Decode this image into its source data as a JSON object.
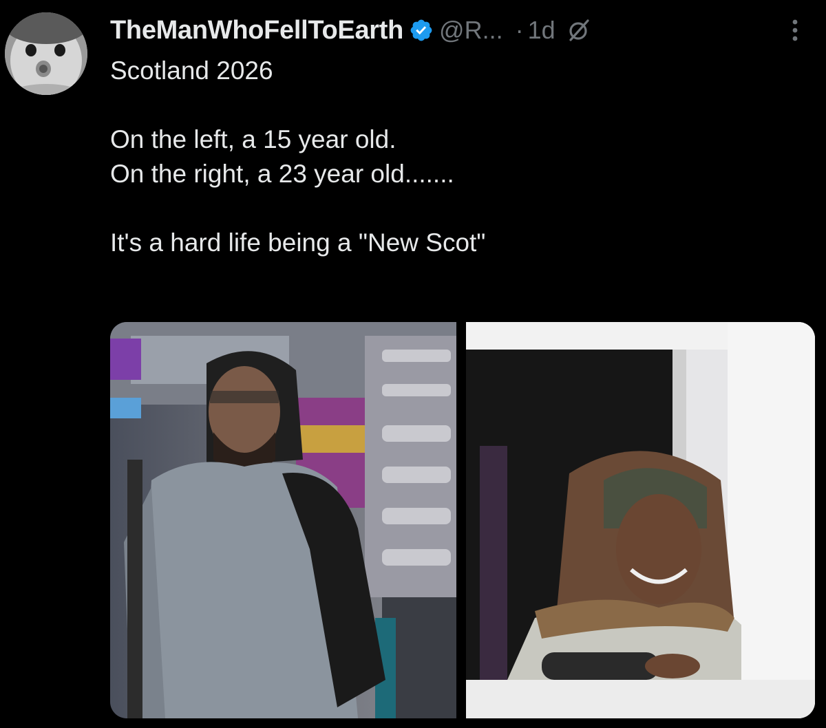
{
  "tweet": {
    "display_name": "TheManWhoFellToEarth",
    "handle": "@R...",
    "separator": "·",
    "time": "1d",
    "lines": [
      "Scotland 2026",
      "",
      "On the left, a 15 year old.",
      "On the right, a 23 year old.......",
      "",
      "It's a hard life being a \"New Scot\""
    ],
    "icons": {
      "verified": "verified-badge-icon",
      "grok": "grok-icon",
      "more": "more-options-icon"
    },
    "colors": {
      "background": "#000000",
      "text": "#e7e9ea",
      "secondary": "#71767b",
      "verified": "#1d9bf0"
    }
  }
}
